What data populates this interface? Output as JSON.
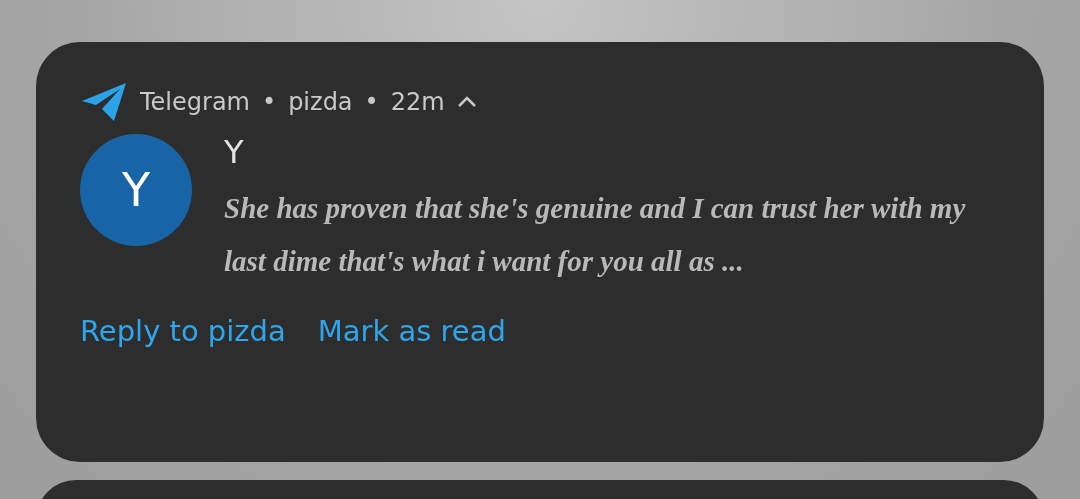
{
  "notification": {
    "app_name": "Telegram",
    "separator_1": "•",
    "chat": "pizda",
    "separator_2": "•",
    "time": "22m",
    "avatar_letter": "Y",
    "title": "Y",
    "message": "She has proven that she's genuine and I can trust her with my last dime that's what i want for you all as ...",
    "actions": [
      {
        "label": "Reply to pizda"
      },
      {
        "label": "Mark as read"
      }
    ]
  },
  "next_notification": {
    "kind": "card"
  }
}
